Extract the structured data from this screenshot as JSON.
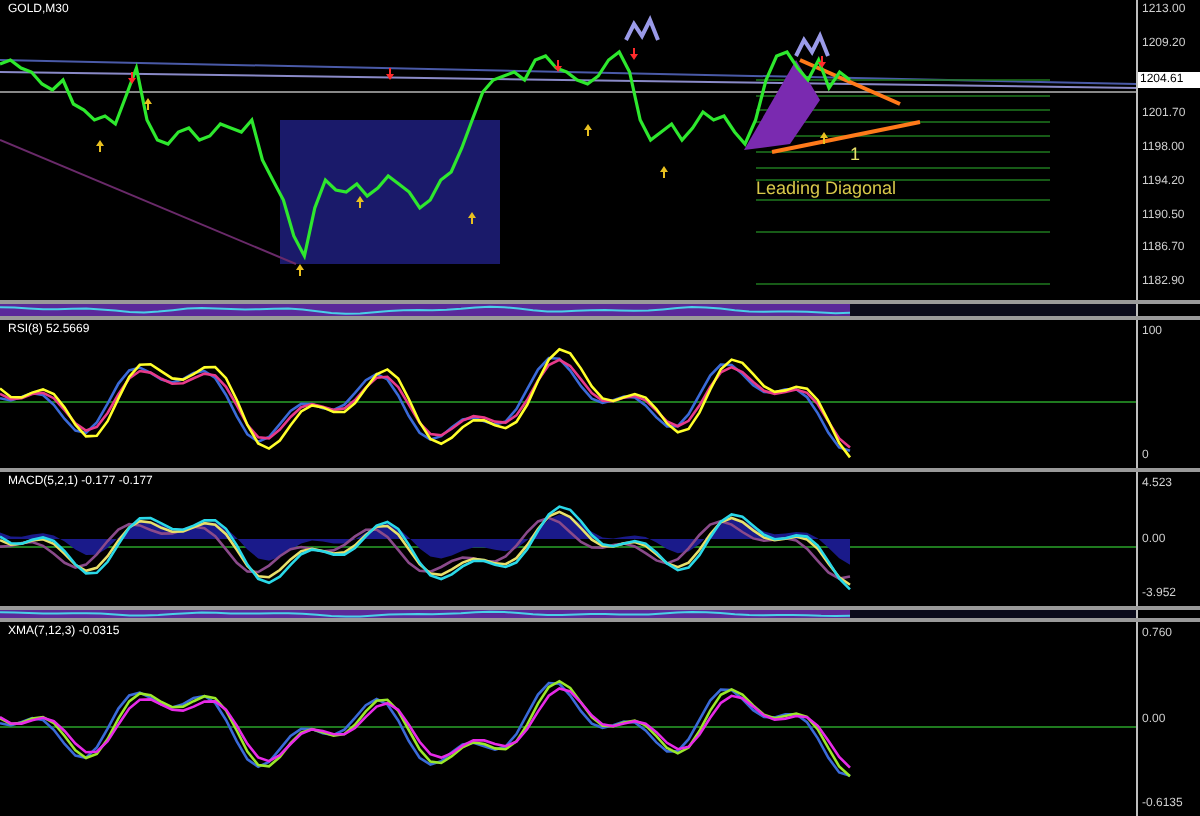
{
  "chart": {
    "symbol_label": "GOLD,M30",
    "pattern_label": "Leading Diagonal",
    "wave_label": "1",
    "price_axis": [
      {
        "text": "1213.00",
        "kind": "tick"
      },
      {
        "text": "1209.20",
        "kind": "tick"
      },
      {
        "text": "1204.61",
        "kind": "current"
      },
      {
        "text": "1201.70",
        "kind": "tick"
      },
      {
        "text": "1198.00",
        "kind": "tick"
      },
      {
        "text": "1194.20",
        "kind": "tick"
      },
      {
        "text": "1190.50",
        "kind": "tick"
      },
      {
        "text": "1186.70",
        "kind": "tick"
      },
      {
        "text": "1182.90",
        "kind": "tick"
      }
    ]
  },
  "panes": [
    {
      "label": "RSI(8) 52.5669",
      "axis": [
        "100",
        "0"
      ]
    },
    {
      "label": "MACD(5,2,1) -0.177 -0.177",
      "axis": [
        "4.523",
        "0.00",
        "-3.952"
      ]
    },
    {
      "label": "XMA(7,12,3) -0.0315",
      "axis": [
        "0.760",
        "0.00",
        "-0.6135"
      ]
    }
  ]
}
